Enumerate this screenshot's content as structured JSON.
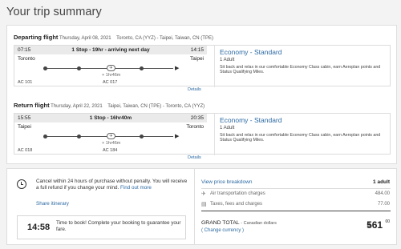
{
  "page": {
    "title": "Your trip summary"
  },
  "departing": {
    "label": "Departing flight",
    "date": "Thursday, April 08, 2021",
    "route": "Toronto, CA (YYZ) - Taipei, Taiwan, CN (TPE)",
    "dep_time": "07:15",
    "arr_time": "14:15",
    "duration": "1 Stop - 19hr - arriving next day",
    "from_city": "Toronto",
    "to_city": "Taipei",
    "layover": "+ 1hr46m",
    "flight1": "AC 101",
    "flight2": "AC 017",
    "cabin": "Economy - Standard",
    "pax": "1 Adult",
    "cabin_desc": "Sit back and relax in our comfortable Economy Class cabin, earn Aeroplan points and Status Qualifying Miles.",
    "details_link": "Details"
  },
  "return": {
    "label": "Return flight",
    "date": "Thursday, April 22, 2021",
    "route": "Taipei, Taiwan, CN (TPE) - Toronto, CA (YYZ)",
    "dep_time": "15:55",
    "arr_time": "20:35",
    "duration": "1 Stop - 16hr40m",
    "from_city": "Taipei",
    "to_city": "Toronto",
    "layover": "+ 1hr46m",
    "flight1": "AC 018",
    "flight2": "AC 184",
    "cabin": "Economy - Standard",
    "pax": "1 Adult",
    "cabin_desc": "Sit back and relax in our comfortable Economy Class cabin, earn Aeroplan points and Status Qualifying Miles.",
    "details_link": "Details"
  },
  "cancel": {
    "text": "Cancel within 24 hours of purchase without penalty. You will receive a full refund if you change your mind.",
    "find_out_more": "Find out more",
    "share": "Share itinerary"
  },
  "timer": {
    "value": "14:58",
    "text": "Time to book! Complete your booking to guarantee your fare."
  },
  "pricing": {
    "view_breakdown": "View price breakdown",
    "pax_header": "1 adult",
    "air_label": "Air transportation charges",
    "air_value": "484.00",
    "taxes_label": "Taxes, fees and charges",
    "taxes_value": "77.00",
    "grand_label": "GRAND TOTAL",
    "grand_currency_note": "- Canadian dollars",
    "change_currency": "( Change currency )",
    "currency_symbol": "$",
    "total": "561",
    "total_cents": "00"
  }
}
